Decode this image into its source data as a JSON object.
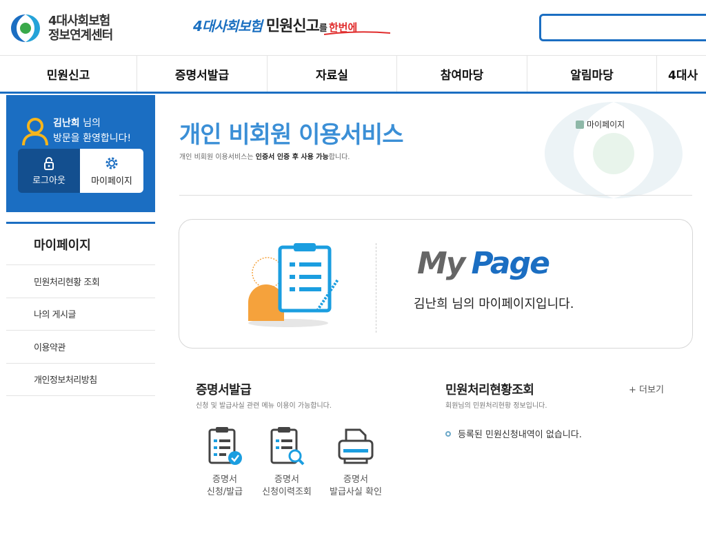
{
  "header": {
    "logo_line1": "4대사회보험",
    "logo_line2": "정보연계센터",
    "slogan_part1": "4대사회보험",
    "slogan_part2": "민원신고",
    "slogan_part3": "를",
    "slogan_part4": "한번에",
    "search_value": ""
  },
  "gnb": {
    "items": [
      "민원신고",
      "증명서발급",
      "자료실",
      "참여마당",
      "알림마당",
      "4대사"
    ]
  },
  "sidebar": {
    "user_name": "김난희",
    "user_suffix": "님의",
    "welcome": "방문을 환영합니다!",
    "logout_label": "로그아웃",
    "mypage_label": "마이페이지",
    "menu_title": "마이페이지",
    "menu_items": [
      "민원처리현황 조회",
      "나의 게시글",
      "이용약관",
      "개인정보처리방침"
    ]
  },
  "content": {
    "title": "개인 비회원 이용서비스",
    "desc_prefix": "개인 비회원 이용서비스는 ",
    "desc_bold": "인증서 인증 후 사용 가능",
    "desc_suffix": "합니다.",
    "breadcrumb": "마이페이지",
    "mypage_logo_my": "My",
    "mypage_logo_page": "Page",
    "mypage_text": "김난희 님의 마이페이지입니다."
  },
  "cert_section": {
    "title": "증명서발급",
    "desc": "신청 및 발급사실 관련 메뉴 이용이 가능합니다.",
    "items": [
      {
        "line1": "증명서",
        "line2": "신청/발급"
      },
      {
        "line1": "증명서",
        "line2": "신청이력조회"
      },
      {
        "line1": "증명서",
        "line2": "발급사실 확인"
      }
    ]
  },
  "status_section": {
    "title": "민원처리현황조회",
    "desc": "회원님의 민원처리현황 정보입니다.",
    "more_label": "+ 더보기",
    "empty_text": "등록된 민원신청내역이 없습니다."
  },
  "colors": {
    "primary": "#1b6ec2",
    "primary_dark": "#134f8f",
    "title_blue": "#3b8fd6",
    "accent_orange": "#f5a23c",
    "accent_red": "#e02a2a"
  }
}
